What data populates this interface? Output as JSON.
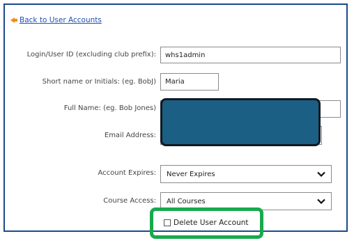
{
  "header": {
    "back_link": "Back to User Accounts"
  },
  "form": {
    "login_label": "Login/User ID (excluding club prefix):",
    "login_value": "whs1admin",
    "short_label": "Short name or Initials: (eg. BobJ)",
    "short_value": "Maria",
    "full_label": "Full Name: (eg. Bob Jones)",
    "email_label": "Email Address:",
    "expires_label": "Account Expires:",
    "expires_value": "Never Expires",
    "course_label": "Course Access:",
    "course_value": "All Courses",
    "delete_label": "Delete User Account"
  },
  "colors": {
    "redaction": "#1b5f84",
    "highlight": "#18a94c",
    "frame": "#1b4a8a",
    "link": "#1f4fb5"
  }
}
